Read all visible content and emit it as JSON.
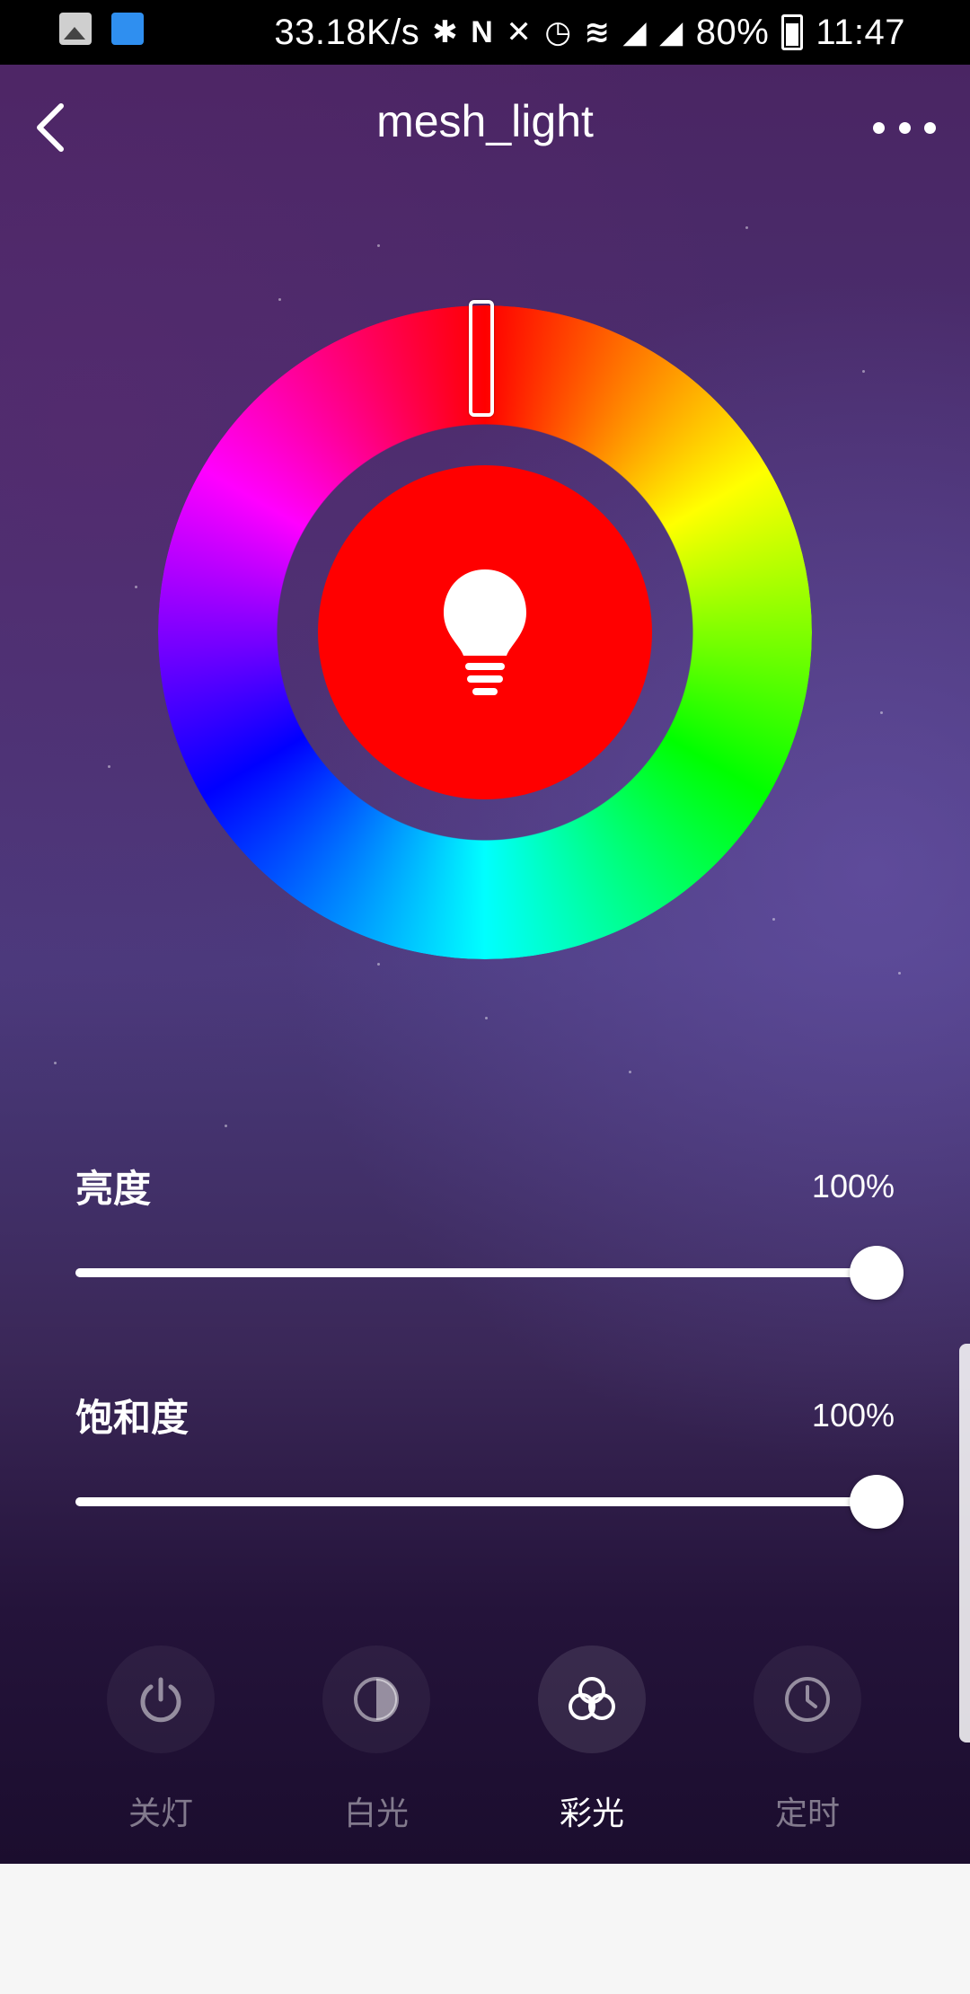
{
  "status_bar": {
    "net_speed": "33.18K/s",
    "battery": "80%",
    "time": "11:47",
    "icons": [
      "gallery-icon",
      "app-notification-icon",
      "bluetooth-icon",
      "nfc-icon",
      "mute-icon",
      "alarm-icon",
      "wifi-icon",
      "signal-4g-icon",
      "signal-4g-icon",
      "battery-icon"
    ]
  },
  "header": {
    "title": "mesh_light",
    "back_icon": "chevron-left-icon",
    "more_icon": "more-dots-icon"
  },
  "color_picker": {
    "selected_color": "#ff0000",
    "hue_degrees": 0,
    "center_icon": "lightbulb-icon"
  },
  "brightness": {
    "label": "亮度",
    "value_text": "100%",
    "value": 1.0
  },
  "saturation": {
    "label": "饱和度",
    "value_text": "100%",
    "value": 1.0
  },
  "modes": [
    {
      "label": "关灯",
      "icon": "power-icon",
      "active": false
    },
    {
      "label": "白光",
      "icon": "half-circle-icon",
      "active": false
    },
    {
      "label": "彩光",
      "icon": "color-circles-icon",
      "active": true
    },
    {
      "label": "定时",
      "icon": "clock-icon",
      "active": false
    }
  ]
}
